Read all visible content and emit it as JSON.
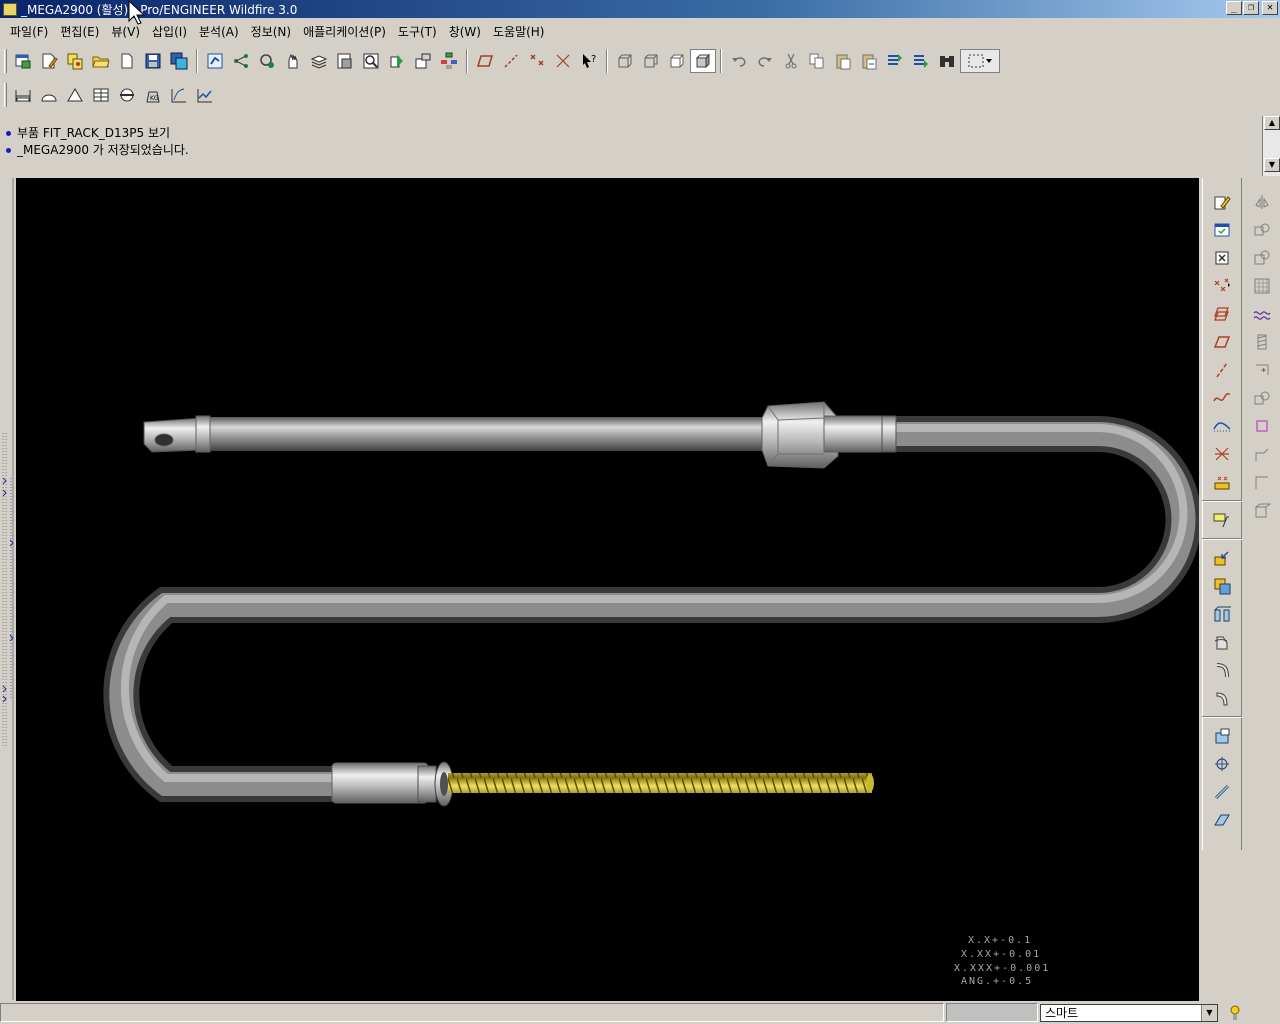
{
  "window": {
    "title": "_MEGA2900 (활성) - Pro/ENGINEER Wildfire 3.0",
    "minimize_glyph": "_",
    "restore_glyph": "❐",
    "close_glyph": "✕"
  },
  "menu": [
    {
      "label": "파일(F)"
    },
    {
      "label": "편집(E)"
    },
    {
      "label": "뷰(V)"
    },
    {
      "label": "삽입(I)"
    },
    {
      "label": "분석(A)"
    },
    {
      "label": "정보(N)"
    },
    {
      "label": "애플리케이션(P)"
    },
    {
      "label": "도구(T)"
    },
    {
      "label": "창(W)"
    },
    {
      "label": "도움말(H)"
    }
  ],
  "messages": [
    {
      "text": "부품 FIT_RACK_D13P5 보기"
    },
    {
      "text": "_MEGA2900 가 저장되었습니다."
    }
  ],
  "status": {
    "filter_value": "스마트"
  },
  "tolerance_table": [
    {
      "text": "X.X+-0.1"
    },
    {
      "text": "X.XX+-0.01"
    },
    {
      "text": "X.XXX+-0.001"
    },
    {
      "text": "ANG.+-0.5"
    }
  ],
  "colors": {
    "viewport_bg": "#000000",
    "pipe": "#a8a8a8",
    "thread": "#d8c828",
    "title_start": "#0a246a"
  }
}
